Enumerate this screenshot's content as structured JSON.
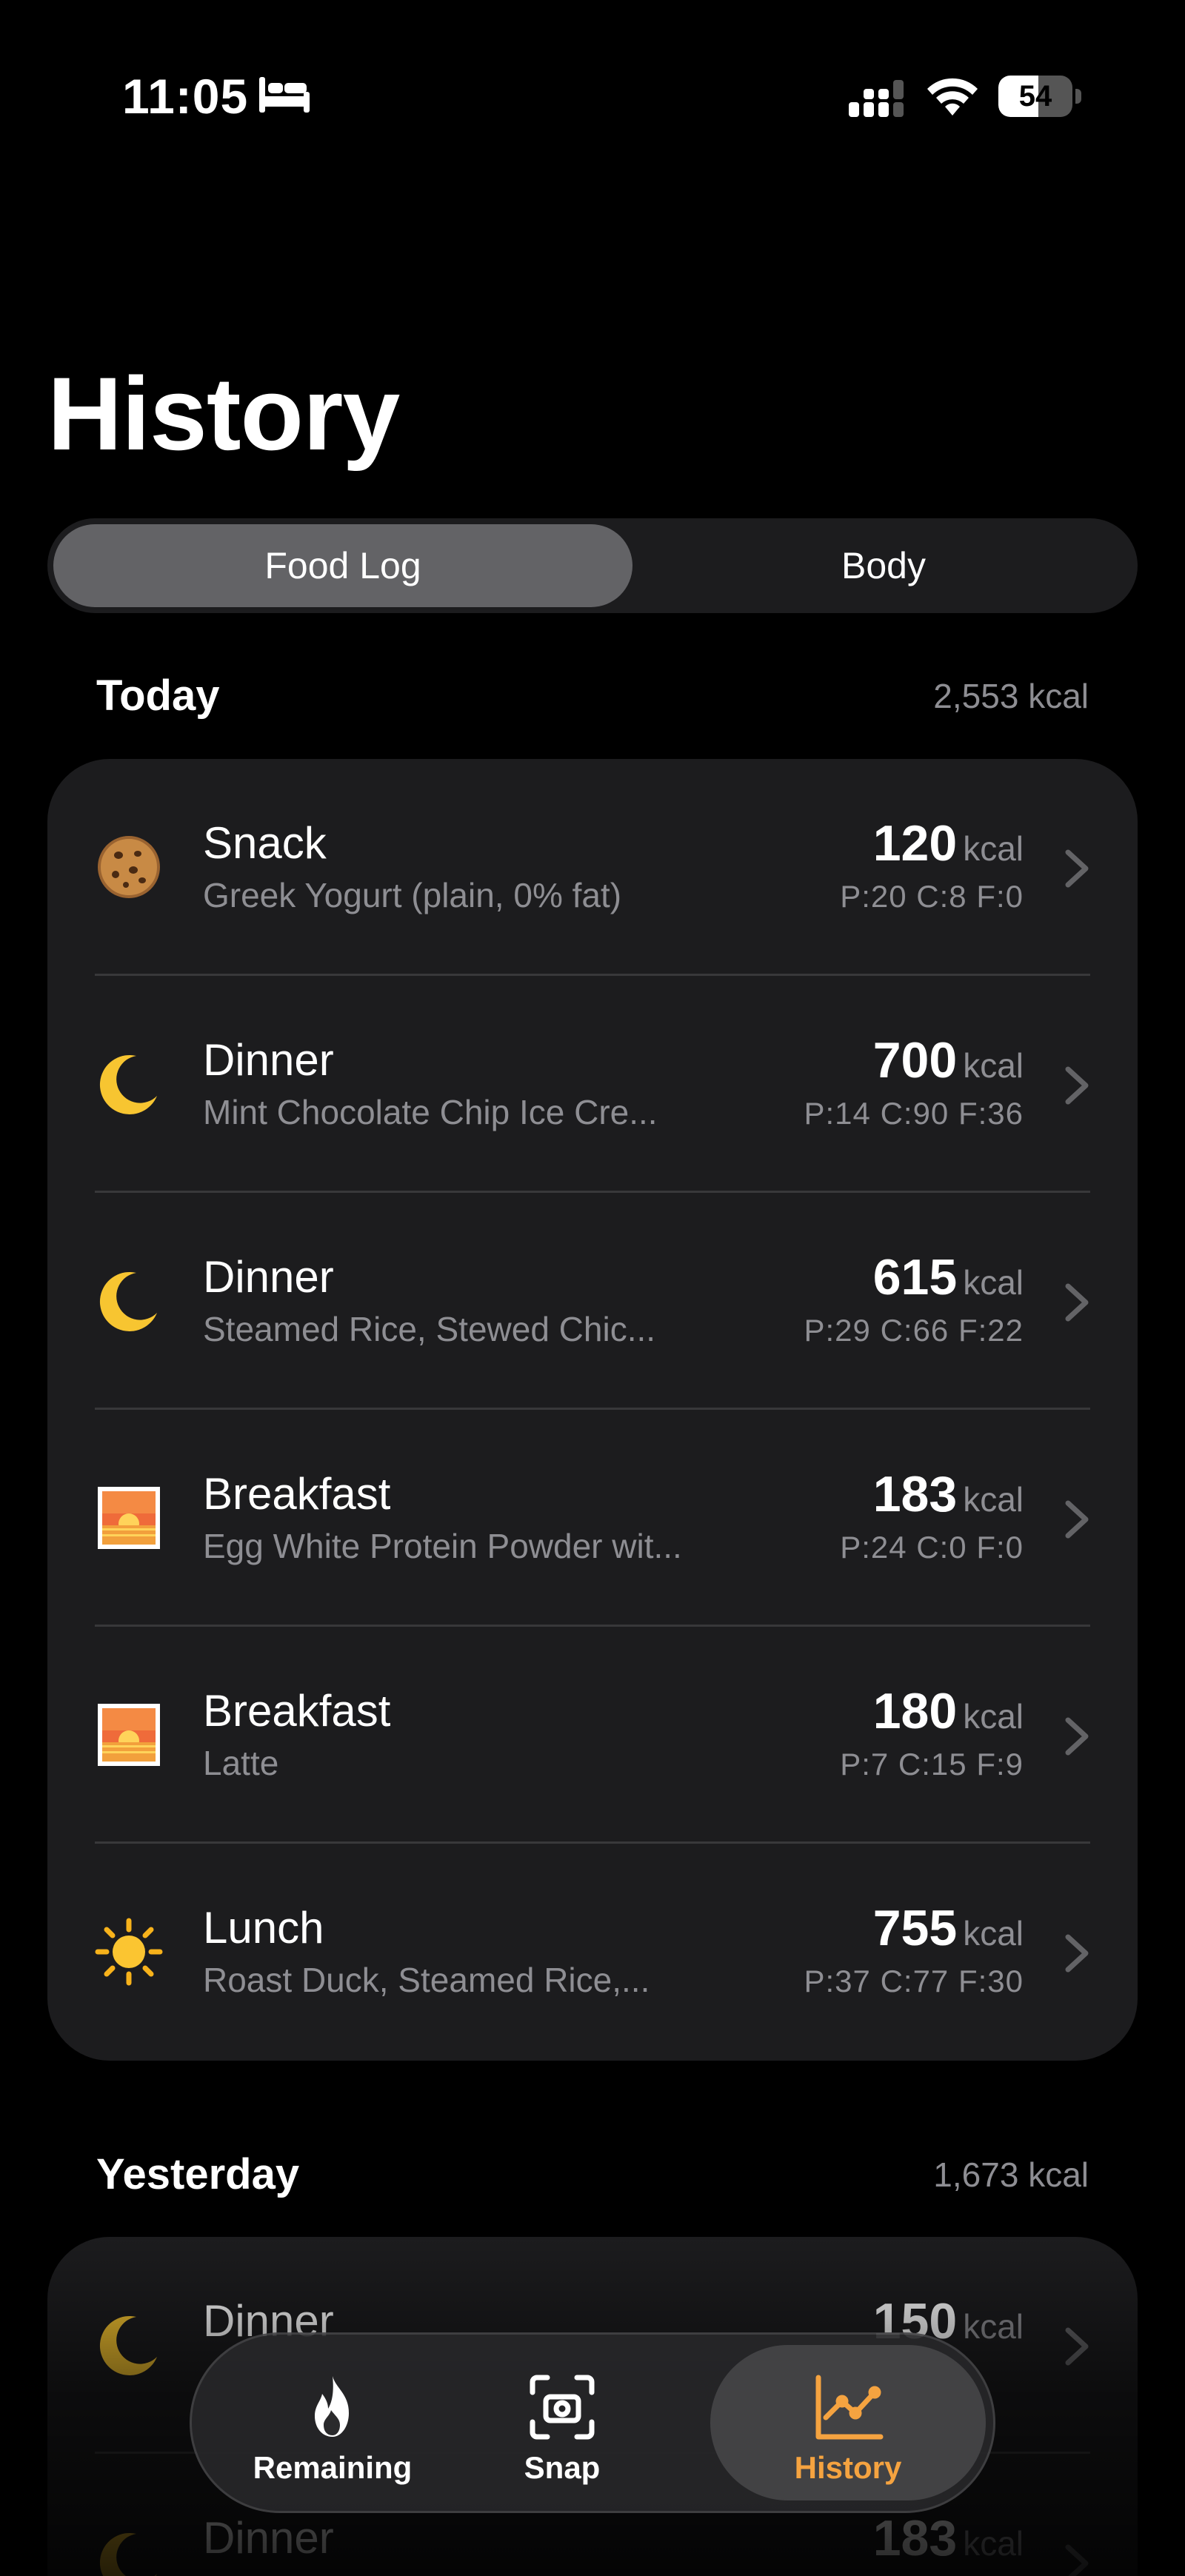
{
  "status_bar": {
    "time": "11:05",
    "battery": "54",
    "battery_level": 0.54
  },
  "page_title": "History",
  "segmented": {
    "food_log": "Food Log",
    "body": "Body"
  },
  "today": {
    "title": "Today",
    "total": "2,553 kcal",
    "entries": [
      {
        "meal": "Snack",
        "desc": "Greek Yogurt (plain, 0% fat)",
        "kcal": "120",
        "unit": "kcal",
        "macros": "P:20 C:8 F:0",
        "icon": "cookie-icon"
      },
      {
        "meal": "Dinner",
        "desc": "Mint Chocolate Chip Ice Cre...",
        "kcal": "700",
        "unit": "kcal",
        "macros": "P:14 C:90 F:36",
        "icon": "moon-icon"
      },
      {
        "meal": "Dinner",
        "desc": "Steamed Rice, Stewed Chic...",
        "kcal": "615",
        "unit": "kcal",
        "macros": "P:29 C:66 F:22",
        "icon": "moon-icon"
      },
      {
        "meal": "Breakfast",
        "desc": "Egg White Protein Powder wit...",
        "kcal": "183",
        "unit": "kcal",
        "macros": "P:24 C:0 F:0",
        "icon": "sunrise-icon"
      },
      {
        "meal": "Breakfast",
        "desc": "Latte",
        "kcal": "180",
        "unit": "kcal",
        "macros": "P:7 C:15 F:9",
        "icon": "sunrise-icon"
      },
      {
        "meal": "Lunch",
        "desc": "Roast Duck, Steamed Rice,...",
        "kcal": "755",
        "unit": "kcal",
        "macros": "P:37 C:77 F:30",
        "icon": "sun-icon"
      }
    ]
  },
  "yesterday": {
    "title": "Yesterday",
    "total": "1,673 kcal",
    "entries": [
      {
        "meal": "Dinner",
        "desc": "",
        "kcal": "150",
        "unit": "kcal",
        "macros": "",
        "icon": "moon-icon"
      },
      {
        "meal": "Dinner",
        "desc": "",
        "kcal": "183",
        "unit": "kcal",
        "macros": "",
        "icon": "moon-icon"
      }
    ]
  },
  "tab_bar": {
    "remaining": "Remaining",
    "snap": "Snap",
    "history": "History"
  },
  "colors": {
    "accent": "#f5a340",
    "card": "#1c1c1e",
    "secondary_text": "#8e8e93"
  }
}
